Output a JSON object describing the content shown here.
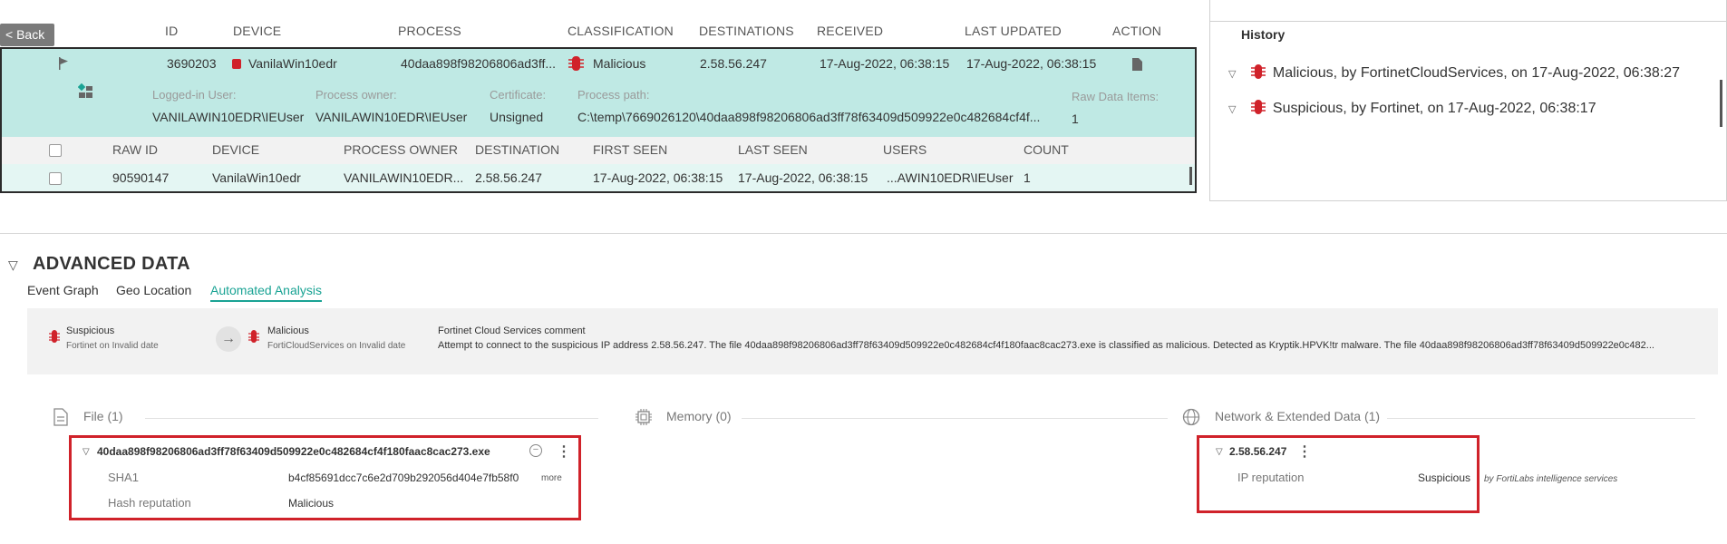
{
  "events_table": {
    "back_label": "< Back",
    "headers": {
      "id": "ID",
      "device": "DEVICE",
      "process": "PROCESS",
      "classification": "CLASSIFICATION",
      "destinations": "DESTINATIONS",
      "received": "RECEIVED",
      "last_updated": "LAST UPDATED",
      "action": "ACTION"
    },
    "row": {
      "id": "3690203",
      "device": "VanilaWin10edr",
      "process": "40daa898f98206806ad3ff...",
      "classification": "Malicious",
      "destinations": "2.58.56.247",
      "received": "17-Aug-2022, 06:38:15",
      "last_updated": "17-Aug-2022, 06:38:15"
    },
    "details": {
      "logged_in_user_label": "Logged-in User:",
      "logged_in_user": "VANILAWIN10EDR\\IEUser",
      "process_owner_label": "Process owner:",
      "process_owner": "VANILAWIN10EDR\\IEUser",
      "certificate_label": "Certificate:",
      "certificate": "Unsigned",
      "process_path_label": "Process path:",
      "process_path": "C:\\temp\\7669026120\\40daa898f98206806ad3ff78f63409d509922e0c482684cf4f...",
      "raw_items_label": "Raw Data Items:",
      "raw_items": "1"
    },
    "raw_headers": {
      "raw_id": "RAW ID",
      "device": "DEVICE",
      "process_owner": "PROCESS OWNER",
      "destination": "DESTINATION",
      "first_seen": "FIRST SEEN",
      "last_seen": "LAST SEEN",
      "users": "USERS",
      "count": "COUNT"
    },
    "raw_row": {
      "raw_id": "90590147",
      "device": "VanilaWin10edr",
      "process_owner": "VANILAWIN10EDR...",
      "destination": "2.58.56.247",
      "first_seen": "17-Aug-2022, 06:38:15",
      "last_seen": "17-Aug-2022, 06:38:15",
      "users": "...AWIN10EDR\\IEUser",
      "count": "1"
    }
  },
  "history": {
    "title": "History",
    "items": [
      "Malicious, by FortinetCloudServices, on 17-Aug-2022, 06:38:27",
      "Suspicious, by Fortinet, on 17-Aug-2022, 06:38:17"
    ]
  },
  "advanced": {
    "title": "ADVANCED DATA",
    "tabs": [
      "Event Graph",
      "Geo Location",
      "Automated Analysis"
    ],
    "active_tab": "Automated Analysis",
    "analysis": {
      "from_title": "Suspicious",
      "from_sub": "Fortinet on Invalid date",
      "to_title": "Malicious",
      "to_sub": "FortiCloudServices on Invalid date",
      "comment_title": "Fortinet Cloud Services comment",
      "comment_text": "Attempt to connect to the suspicious IP address 2.58.56.247. The file 40daa898f98206806ad3ff78f63409d509922e0c482684cf4f180faac8cac273.exe is classified as malicious. Detected as Kryptik.HPVK!tr malware. The file 40daa898f98206806ad3ff78f63409d509922e0c482..."
    },
    "sections": {
      "file": "File (1)",
      "memory": "Memory (0)",
      "network": "Network & Extended Data (1)"
    },
    "file": {
      "name": "40daa898f98206806ad3ff78f63409d509922e0c482684cf4f180faac8cac273.exe",
      "sha1_label": "SHA1",
      "sha1": "b4cf85691dcc7c6e2d709b292056d404e7fb58f0",
      "more": "more",
      "hash_rep_label": "Hash reputation",
      "hash_rep": "Malicious"
    },
    "network": {
      "ip": "2.58.56.247",
      "ip_rep_label": "IP reputation",
      "ip_rep": "Suspicious",
      "by": "by FortiLabs intelligence services"
    }
  },
  "colors": {
    "accent": "#1aa394",
    "malicious": "#d0222a",
    "row_bg": "#bfe9e4"
  }
}
